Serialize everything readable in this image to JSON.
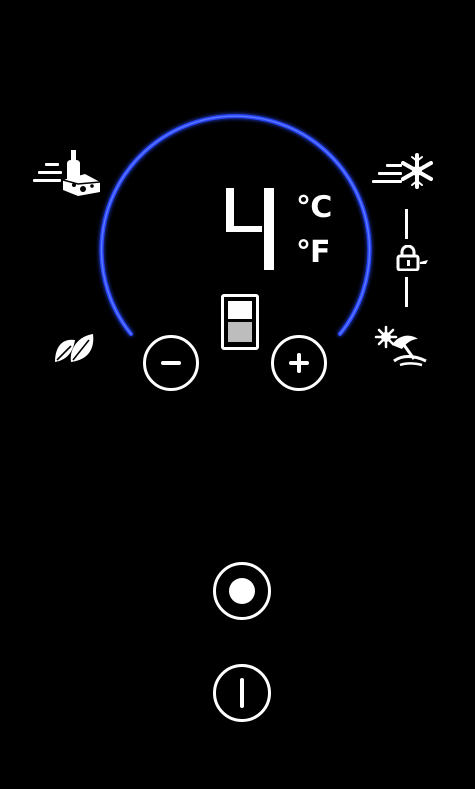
{
  "display": {
    "temperature_value": "4",
    "unit_celsius": "℃",
    "unit_fahrenheit": "°F"
  },
  "icons": {
    "left_top": "bottle-cheese-fast-cool-icon",
    "left_bottom": "eco-leaf-icon",
    "right_top": "fast-freeze-snowflake-icon",
    "right_middle": "child-lock-icon",
    "right_bottom": "holiday-beach-icon",
    "center": "door-compartment-icon"
  },
  "buttons": {
    "minus": "minus-button",
    "plus": "plus-button",
    "select": "select-button",
    "power": "power-button"
  },
  "colors": {
    "background": "#000000",
    "arc": "#2b49ff",
    "foreground": "#ffffff"
  }
}
